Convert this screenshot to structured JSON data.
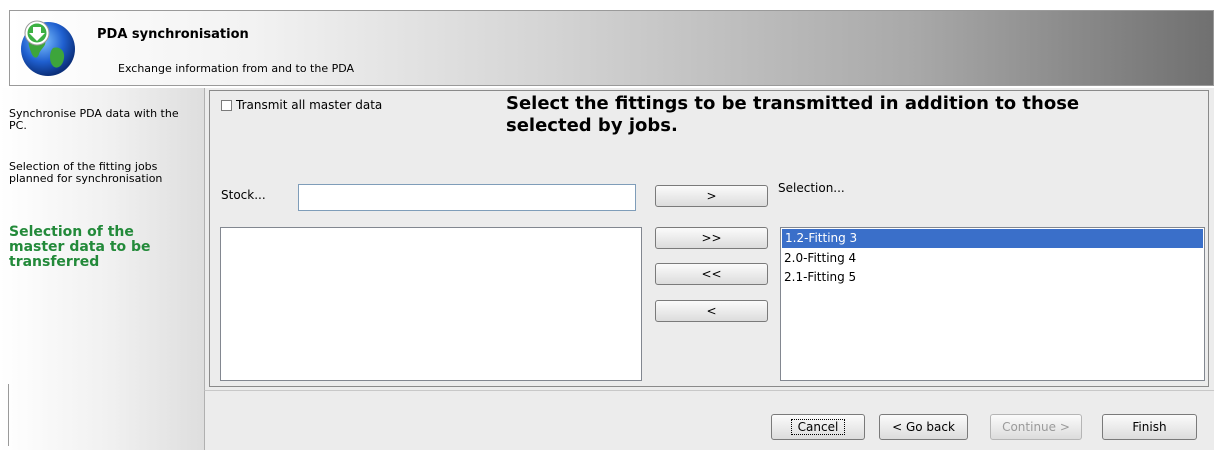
{
  "header": {
    "title": "PDA synchronisation",
    "subtitle": "Exchange information from and to the PDA",
    "icon": "globe-download-icon"
  },
  "sidebar": {
    "steps": [
      {
        "label": "Synchronise PDA data with the PC.",
        "active": false
      },
      {
        "label": "Selection of the fitting jobs planned for synchronisation",
        "active": false
      },
      {
        "label": "Selection of the master data to be transferred",
        "active": true
      }
    ],
    "active_color": "#238a3a"
  },
  "main": {
    "transmit_all_label": "Transmit all master data",
    "transmit_all_checked": false,
    "instruction": "Select the fittings to be transmitted in addition to those selected by jobs.",
    "stock_label": "Stock...",
    "stock_value": "",
    "selection_label": "Selection...",
    "stock_items": [],
    "selection_items": [
      {
        "label": "1.2-Fitting 3",
        "selected": true
      },
      {
        "label": "2.0-Fitting 4",
        "selected": false
      },
      {
        "label": "2.1-Fitting 5",
        "selected": false
      }
    ],
    "move_buttons": {
      "add_one": ">",
      "add_all": ">>",
      "remove_all": "<<",
      "remove_one": "<"
    },
    "selection_highlight": "#3a6fc9"
  },
  "footer": {
    "cancel": "Cancel",
    "back": "< Go back",
    "continue": "Continue >",
    "continue_enabled": false,
    "finish": "Finish"
  }
}
